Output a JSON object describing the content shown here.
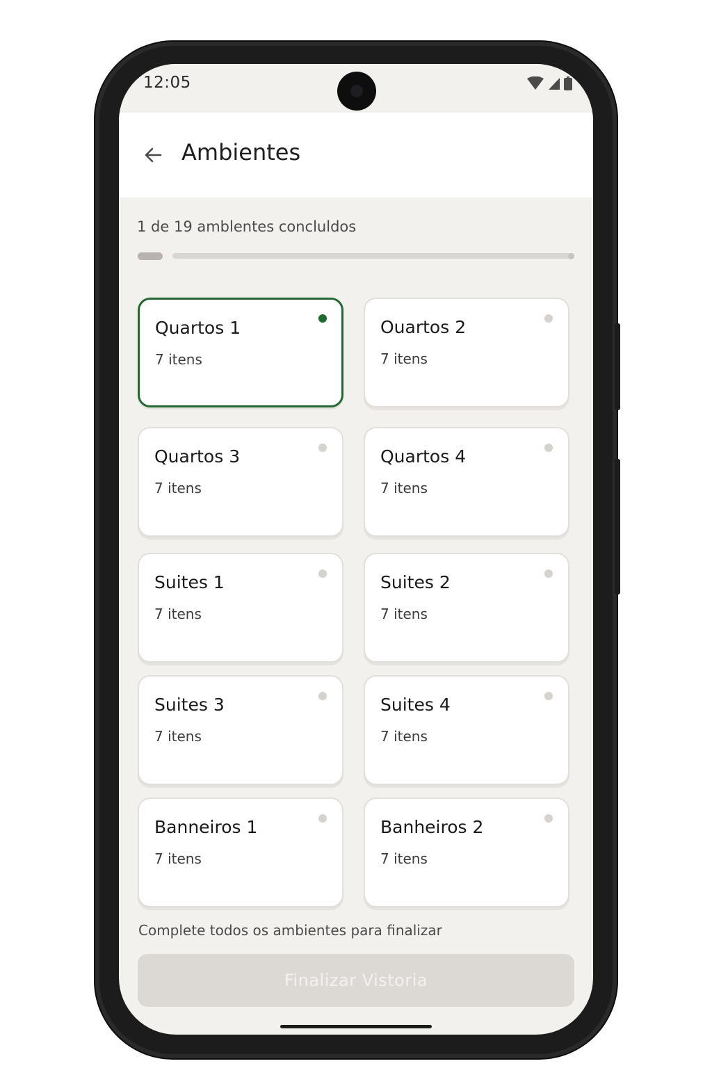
{
  "status_bar": {
    "time": "12:05",
    "icons": [
      "wifi-icon",
      "signal-icon",
      "battery-icon"
    ]
  },
  "header": {
    "title": "Ambientes",
    "back_icon": "arrow-left-icon"
  },
  "progress": {
    "text": "1 de 19 amblentes concluldos",
    "completed": 1,
    "total": 19
  },
  "rooms": [
    {
      "name": "Quartos 1",
      "items": "7 itens",
      "active": true
    },
    {
      "name": "Ouartos 2",
      "items": "7 itens",
      "active": false
    },
    {
      "name": "Quartos 3",
      "items": "7 itens",
      "active": false
    },
    {
      "name": "Quartos 4",
      "items": "7 itens",
      "active": false
    },
    {
      "name": "Suites 1",
      "items": "7 itens",
      "active": false
    },
    {
      "name": "Suites 2",
      "items": "7 itens",
      "active": false
    },
    {
      "name": "Suites 3",
      "items": "7 itens",
      "active": false
    },
    {
      "name": "Suites 4",
      "items": "7 itens",
      "active": false
    },
    {
      "name": "Banneiros 1",
      "items": "7 itens",
      "active": false
    },
    {
      "name": "Banheiros 2",
      "items": "7 itens",
      "active": false
    }
  ],
  "footer": {
    "hint": "Complete todos os ambientes para finalizar",
    "button_label": "Finalizar Vistoria",
    "button_enabled": false
  },
  "colors": {
    "accent": "#1e6b2e",
    "screen_bg": "#f3f1ee",
    "card_bg": "#ffffff",
    "button_disabled_bg": "#dcd8d4"
  }
}
